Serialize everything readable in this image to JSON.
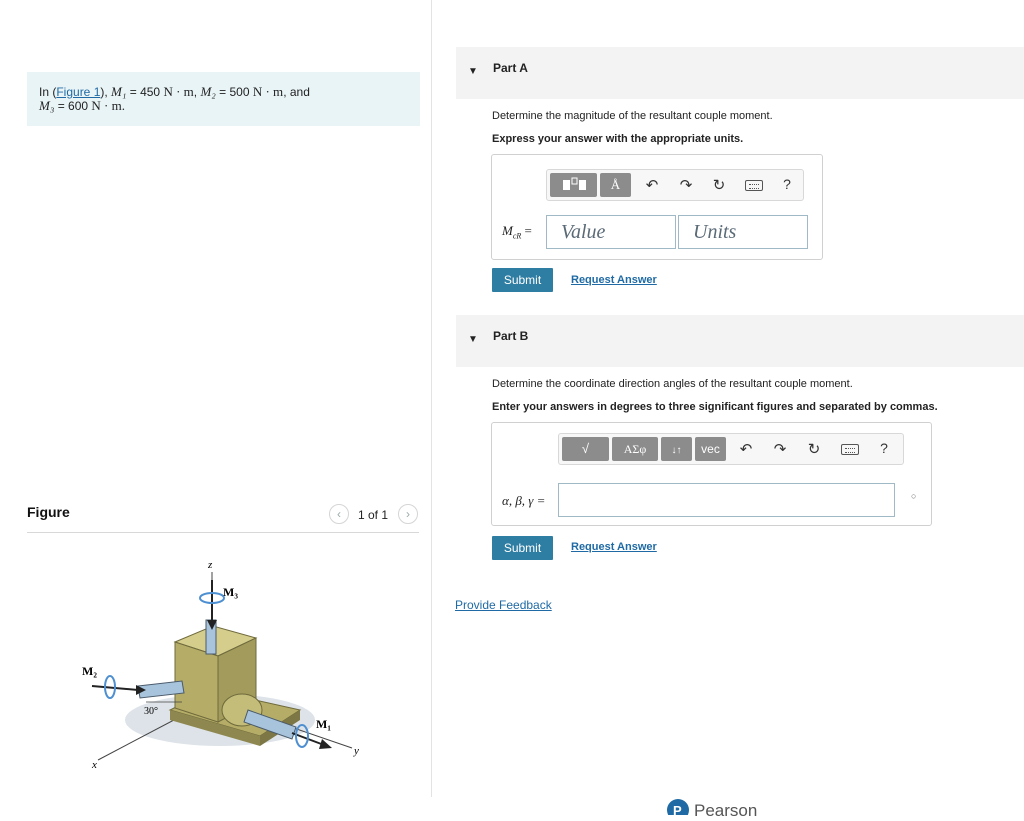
{
  "problem": {
    "prefix": "In (",
    "figure_link": "Figure 1",
    "after_link": "), ",
    "m1": "M₁",
    "m1_val": " = 450 ",
    "m2": "M₂",
    "m2_val": " = 500 ",
    "m3": "M₃",
    "m3_val": " = 600 ",
    "unit": "N · m",
    "comma": ", ",
    "and": ", and",
    "period": "."
  },
  "figure": {
    "title": "Figure",
    "pager_text": "1 of 1",
    "prev_icon": "‹",
    "next_icon": "›",
    "labels": {
      "z": "z",
      "x": "x",
      "y": "y",
      "m1": "M₁",
      "m2": "M₂",
      "m3": "M₃",
      "angle": "30°"
    }
  },
  "partA": {
    "title": "Part A",
    "question": "Determine the magnitude of the resultant couple moment.",
    "instruction": "Express your answer with the appropriate units.",
    "eq_label": "M",
    "eq_sub": "cR",
    "eq_sign": " =",
    "value_placeholder": "Value",
    "units_placeholder": "Units",
    "submit_label": "Submit",
    "request_label": "Request Answer",
    "toolbar": {
      "undo": "undo-icon",
      "redo": "redo-icon",
      "reset": "reset-icon",
      "keyboard": "keyboard-icon",
      "help": "?",
      "angstrom": "Å"
    }
  },
  "partB": {
    "title": "Part B",
    "question": "Determine the coordinate direction angles of the resultant couple moment.",
    "instruction": "Enter your answers in degrees to three significant figures and separated by commas.",
    "eq_label": "α, β, γ =",
    "submit_label": "Submit",
    "request_label": "Request Answer",
    "toolbar": {
      "sqrt": "√",
      "greek": "ΑΣφ",
      "arrows": "↓↑",
      "vec": "vec",
      "help": "?"
    }
  },
  "feedback_label": "Provide Feedback",
  "brand": "Pearson"
}
